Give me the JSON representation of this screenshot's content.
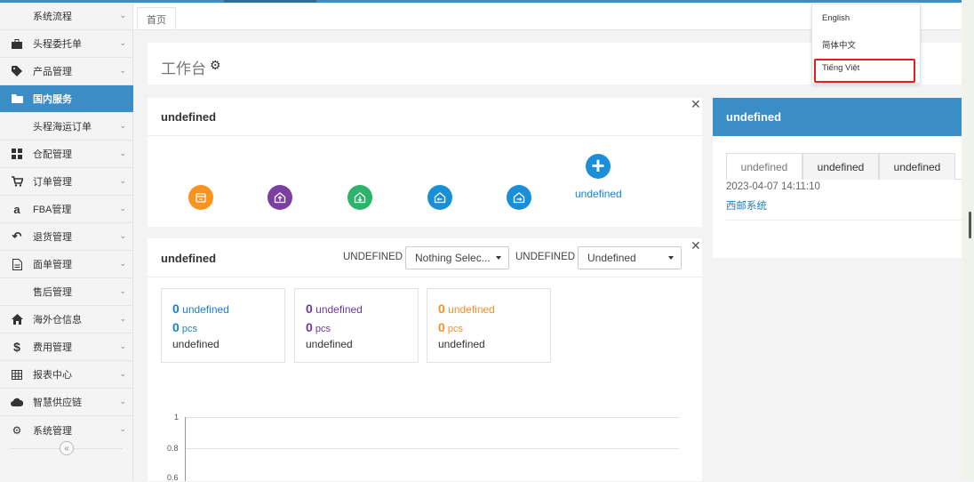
{
  "sidebar": {
    "items": [
      {
        "label": "系统流程",
        "icon": "none",
        "sub": true,
        "active": false
      },
      {
        "label": "头程委托单",
        "icon": "briefcase-icon",
        "sub": false,
        "active": false
      },
      {
        "label": "产品管理",
        "icon": "tag-icon",
        "sub": false,
        "active": false
      },
      {
        "label": "国内服务",
        "icon": "folder-icon",
        "sub": false,
        "active": true
      },
      {
        "label": "头程海运订单",
        "icon": "none",
        "sub": true,
        "active": false
      },
      {
        "label": "仓配管理",
        "icon": "grid-icon",
        "sub": false,
        "active": false
      },
      {
        "label": "订单管理",
        "icon": "cart-icon",
        "sub": false,
        "active": false
      },
      {
        "label": "FBA管理",
        "icon": "amazon-icon",
        "sub": false,
        "active": false
      },
      {
        "label": "退货管理",
        "icon": "return-icon",
        "sub": false,
        "active": false
      },
      {
        "label": "面单管理",
        "icon": "document-icon",
        "sub": false,
        "active": false
      },
      {
        "label": "售后管理",
        "icon": "none",
        "sub": true,
        "active": false
      },
      {
        "label": "海外仓信息",
        "icon": "home-icon",
        "sub": false,
        "active": false
      },
      {
        "label": "费用管理",
        "icon": "dollar-icon",
        "sub": false,
        "active": false
      },
      {
        "label": "报表中心",
        "icon": "table-icon",
        "sub": false,
        "active": false
      },
      {
        "label": "智慧供应链",
        "icon": "cloud-icon",
        "sub": false,
        "active": false
      },
      {
        "label": "系统管理",
        "icon": "gear-icon",
        "sub": false,
        "active": false
      }
    ],
    "collapse_glyph": "«"
  },
  "tabs": {
    "home": "首页"
  },
  "workspace": {
    "title": "工作台"
  },
  "quick_panel": {
    "title": "undefined",
    "add_label": "undefined",
    "icon_colors": [
      "#f7931e",
      "#7b3fa0",
      "#2db36a",
      "#1a8fd8",
      "#1a8fd8"
    ]
  },
  "stats_panel": {
    "title": "undefined",
    "filter1_label": "UNDEFINED",
    "filter1_value": "Nothing Selec...",
    "filter2_label": "UNDEFINED",
    "filter2_value": "Undefined",
    "cards": [
      {
        "count": "0",
        "count_unit": "undefined",
        "qty": "0",
        "qty_unit": "pcs",
        "label": "undefined",
        "color": "#1a7fc8"
      },
      {
        "count": "0",
        "count_unit": "undefined",
        "qty": "0",
        "qty_unit": "pcs",
        "label": "undefined",
        "color": "#6a3a9a"
      },
      {
        "count": "0",
        "count_unit": "undefined",
        "qty": "0",
        "qty_unit": "pcs",
        "label": "undefined",
        "color": "#f0902a"
      }
    ],
    "y_ticks": [
      "1",
      "0.8",
      "0.6"
    ]
  },
  "notice_panel": {
    "title": "undefined",
    "tabs": [
      "undefined",
      "undefined",
      "undefined"
    ],
    "date": "2023-04-07 14:11:10",
    "link": "西邮系统"
  },
  "language_menu": {
    "items": [
      "English",
      "简体中文",
      "Tiếng Việt"
    ],
    "selected_index": 2
  }
}
